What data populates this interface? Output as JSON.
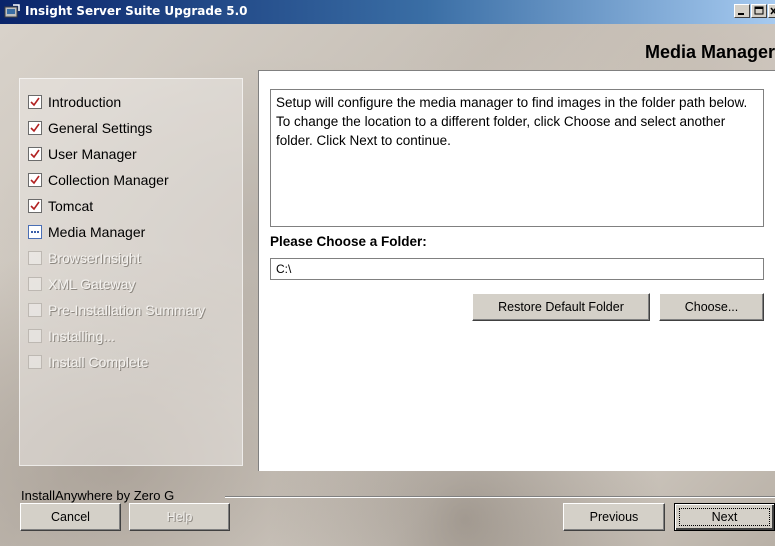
{
  "window": {
    "title": "Insight Server Suite Upgrade 5.0",
    "controls": {
      "minimize": "minimize-icon",
      "maximize": "maximize-icon",
      "close": "close-icon"
    }
  },
  "header": {
    "title": "Media Manager"
  },
  "steps": [
    {
      "label": "Introduction",
      "state": "done"
    },
    {
      "label": "General Settings",
      "state": "done"
    },
    {
      "label": "User Manager",
      "state": "done"
    },
    {
      "label": "Collection Manager",
      "state": "done"
    },
    {
      "label": "Tomcat",
      "state": "done"
    },
    {
      "label": "Media Manager",
      "state": "current"
    },
    {
      "label": "BrowserInsight",
      "state": "pending"
    },
    {
      "label": "XML Gateway",
      "state": "pending"
    },
    {
      "label": "Pre-Installation Summary",
      "state": "pending"
    },
    {
      "label": "Installing...",
      "state": "pending"
    },
    {
      "label": "Install Complete",
      "state": "pending"
    }
  ],
  "main": {
    "description": "Setup will configure the media manager to find images in the folder path below.  To change the location to a different folder, click Choose and select another folder.  Click Next to continue.",
    "folder_label": "Please Choose a Folder:",
    "folder_value": "C:\\",
    "restore_label": "Restore Default Folder",
    "choose_label": "Choose..."
  },
  "footer": {
    "brand": "InstallAnywhere by Zero G",
    "cancel_label": "Cancel",
    "help_label": "Help",
    "previous_label": "Previous",
    "next_label": "Next"
  },
  "colors": {
    "titlebar_start": "#0a246a",
    "titlebar_end": "#a6caf0",
    "check_red": "#b22222",
    "current_blue": "#3b5fa8"
  }
}
